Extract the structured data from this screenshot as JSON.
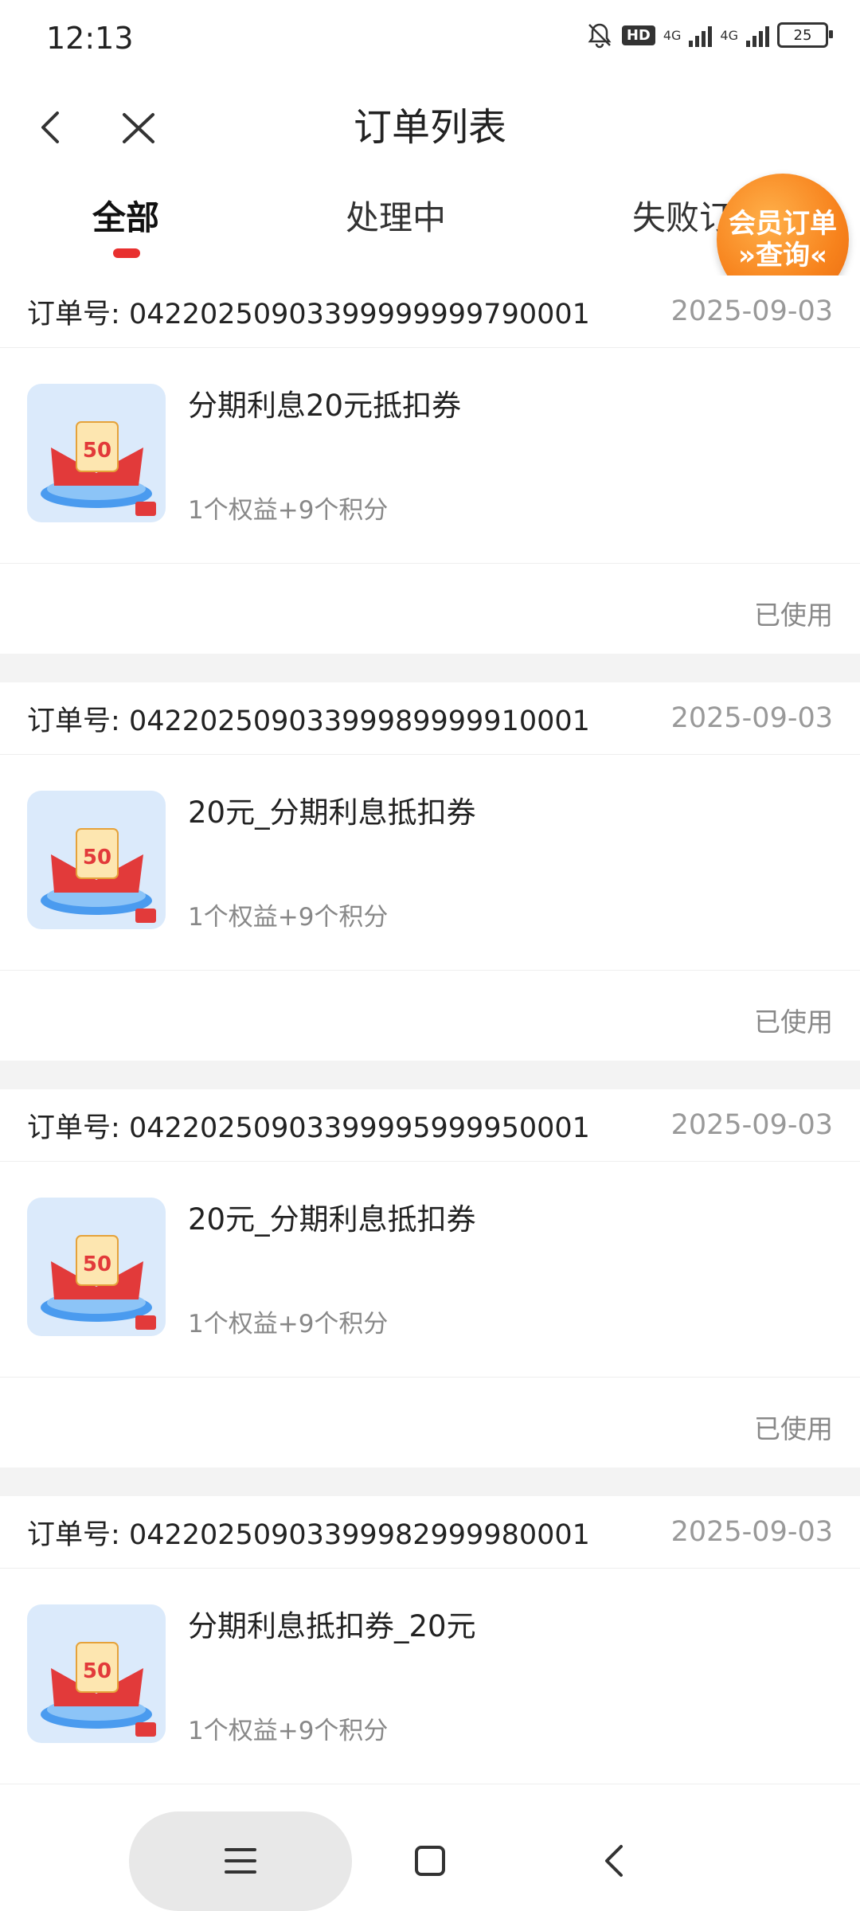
{
  "status_bar": {
    "time": "12:13",
    "hd_label": "HD",
    "net1": "4G",
    "net2": "4G",
    "battery": "25"
  },
  "header": {
    "title": "订单列表"
  },
  "tabs": [
    {
      "label": "全部"
    },
    {
      "label": "处理中"
    },
    {
      "label": "失败订"
    }
  ],
  "float_badge": {
    "line1": "会员订单",
    "line2": "»查询«"
  },
  "orders": [
    {
      "label": "订单号:",
      "number": "04220250903399999999790001",
      "date": "2025-09-03",
      "product": "分期利息20元抵扣券",
      "sub": "1个权益+9个积分",
      "status": "已使用"
    },
    {
      "label": "订单号:",
      "number": "04220250903399989999910001",
      "date": "2025-09-03",
      "product": "20元_分期利息抵扣券",
      "sub": "1个权益+9个积分",
      "status": "已使用"
    },
    {
      "label": "订单号:",
      "number": "04220250903399995999950001",
      "date": "2025-09-03",
      "product": "20元_分期利息抵扣券",
      "sub": "1个权益+9个积分",
      "status": "已使用"
    },
    {
      "label": "订单号:",
      "number": "04220250903399982999980001",
      "date": "2025-09-03",
      "product": "分期利息抵扣券_20元",
      "sub": "1个权益+9个积分",
      "status": ""
    }
  ],
  "thumb_text": "50",
  "icons": {
    "mute": "bell-off-icon",
    "back": "chevron-left-icon",
    "close": "close-icon",
    "nav_menu": "menu-icon",
    "nav_home": "square-home-icon",
    "nav_back": "chevron-left-icon"
  },
  "colors": {
    "accent": "#e8302f",
    "badge": "#f7821c"
  }
}
